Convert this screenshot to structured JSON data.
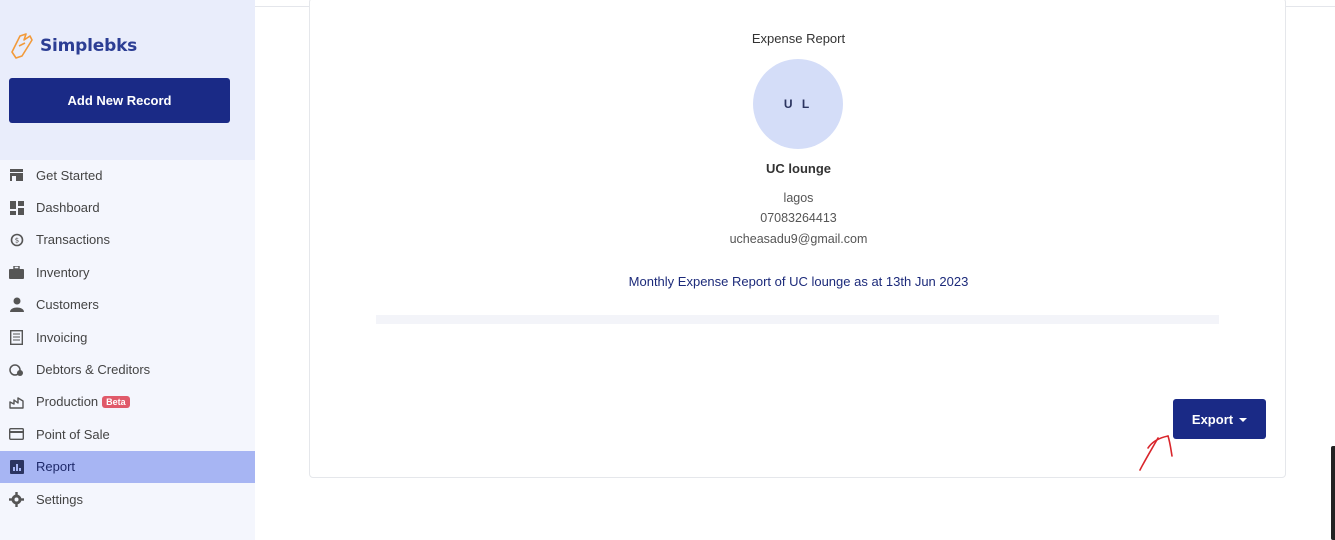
{
  "brand": {
    "name": "Simplebks",
    "accent": "#1a2a86",
    "logo_color": "#f29a3a"
  },
  "sidebar": {
    "add_button": "Add New Record",
    "items": [
      {
        "label": "Get Started",
        "icon": "store-icon"
      },
      {
        "label": "Dashboard",
        "icon": "dashboard-icon"
      },
      {
        "label": "Transactions",
        "icon": "transactions-icon"
      },
      {
        "label": "Inventory",
        "icon": "briefcase-icon"
      },
      {
        "label": "Customers",
        "icon": "user-icon"
      },
      {
        "label": "Invoicing",
        "icon": "invoice-icon"
      },
      {
        "label": "Debtors & Creditors",
        "icon": "debtors-icon"
      },
      {
        "label": "Production",
        "icon": "production-icon",
        "badge": "Beta"
      },
      {
        "label": "Point of Sale",
        "icon": "card-icon"
      },
      {
        "label": "Report",
        "icon": "report-icon",
        "active": true
      },
      {
        "label": "Settings",
        "icon": "gear-icon"
      }
    ]
  },
  "report": {
    "title": "Expense Report",
    "avatar_initials": "U L",
    "business_name": "UC lounge",
    "location": "lagos",
    "phone": "07083264413",
    "email": "ucheasadu9@gmail.com",
    "summary": "Monthly Expense Report of UC lounge as at 13th Jun 2023",
    "export_label": "Export"
  }
}
